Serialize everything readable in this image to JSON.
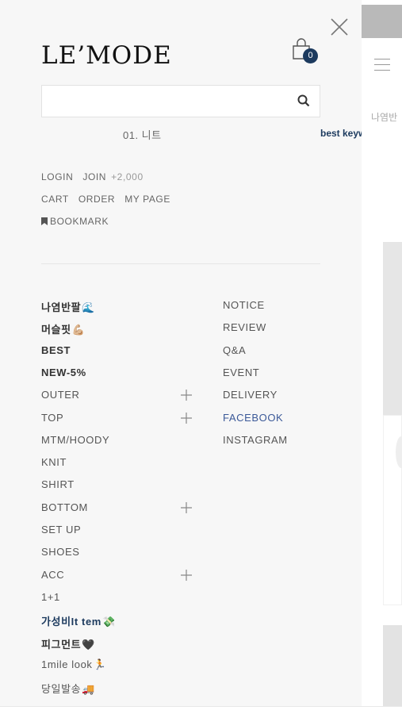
{
  "brand": {
    "logo_text": "LE’MODE"
  },
  "cart": {
    "count": "0",
    "icon": "shopping-bag-icon"
  },
  "search": {
    "placeholder": "",
    "hint": "01. 니트",
    "best_keyword_label": "best keyw"
  },
  "account": {
    "login": "LOGIN",
    "join": "JOIN",
    "join_bonus": "+2,000",
    "cart": "CART",
    "order": "ORDER",
    "my_page": "MY PAGE",
    "bookmark": "BOOKMARK"
  },
  "categories": [
    {
      "label": "나염반팔",
      "emoji": "🌊",
      "style": "bold"
    },
    {
      "label": "머슬핏",
      "emoji": "💪🏼",
      "style": "bold"
    },
    {
      "label": "BEST",
      "emoji": "",
      "style": "bold"
    },
    {
      "label": "NEW-5%",
      "emoji": "",
      "style": "bold"
    },
    {
      "label": "OUTER",
      "emoji": "",
      "style": "normal",
      "expandable": true
    },
    {
      "label": "TOP",
      "emoji": "",
      "style": "normal",
      "expandable": true
    },
    {
      "label": "MTM/HOODY",
      "emoji": "",
      "style": "normal"
    },
    {
      "label": "KNIT",
      "emoji": "",
      "style": "normal"
    },
    {
      "label": "SHIRT",
      "emoji": "",
      "style": "normal"
    },
    {
      "label": "BOTTOM",
      "emoji": "",
      "style": "normal",
      "expandable": true
    },
    {
      "label": "SET UP",
      "emoji": "",
      "style": "normal"
    },
    {
      "label": "SHOES",
      "emoji": "",
      "style": "normal"
    },
    {
      "label": "ACC",
      "emoji": "",
      "style": "normal",
      "expandable": true
    },
    {
      "label": "1+1",
      "emoji": "",
      "style": "normal"
    },
    {
      "label": "가성비It tem",
      "emoji": "💸",
      "style": "navy"
    },
    {
      "label": "피그먼트",
      "emoji": "🖤",
      "style": "bold"
    },
    {
      "label": "1mile look",
      "emoji": "🏃",
      "style": "normal"
    },
    {
      "label": "당일발송",
      "emoji": "🚚",
      "style": "normal"
    }
  ],
  "community": [
    {
      "label": "NOTICE"
    },
    {
      "label": "REVIEW"
    },
    {
      "label": "Q&A"
    },
    {
      "label": "EVENT"
    },
    {
      "label": "DELIVERY"
    },
    {
      "label": "FACEBOOK"
    },
    {
      "label": "INSTAGRAM"
    }
  ],
  "background_page": {
    "keyword_text": "나염반"
  },
  "colors": {
    "accent_navy": "#1c3a5e",
    "facebook_blue": "#3b5998",
    "drawer_bg": "#f7f7f7"
  }
}
